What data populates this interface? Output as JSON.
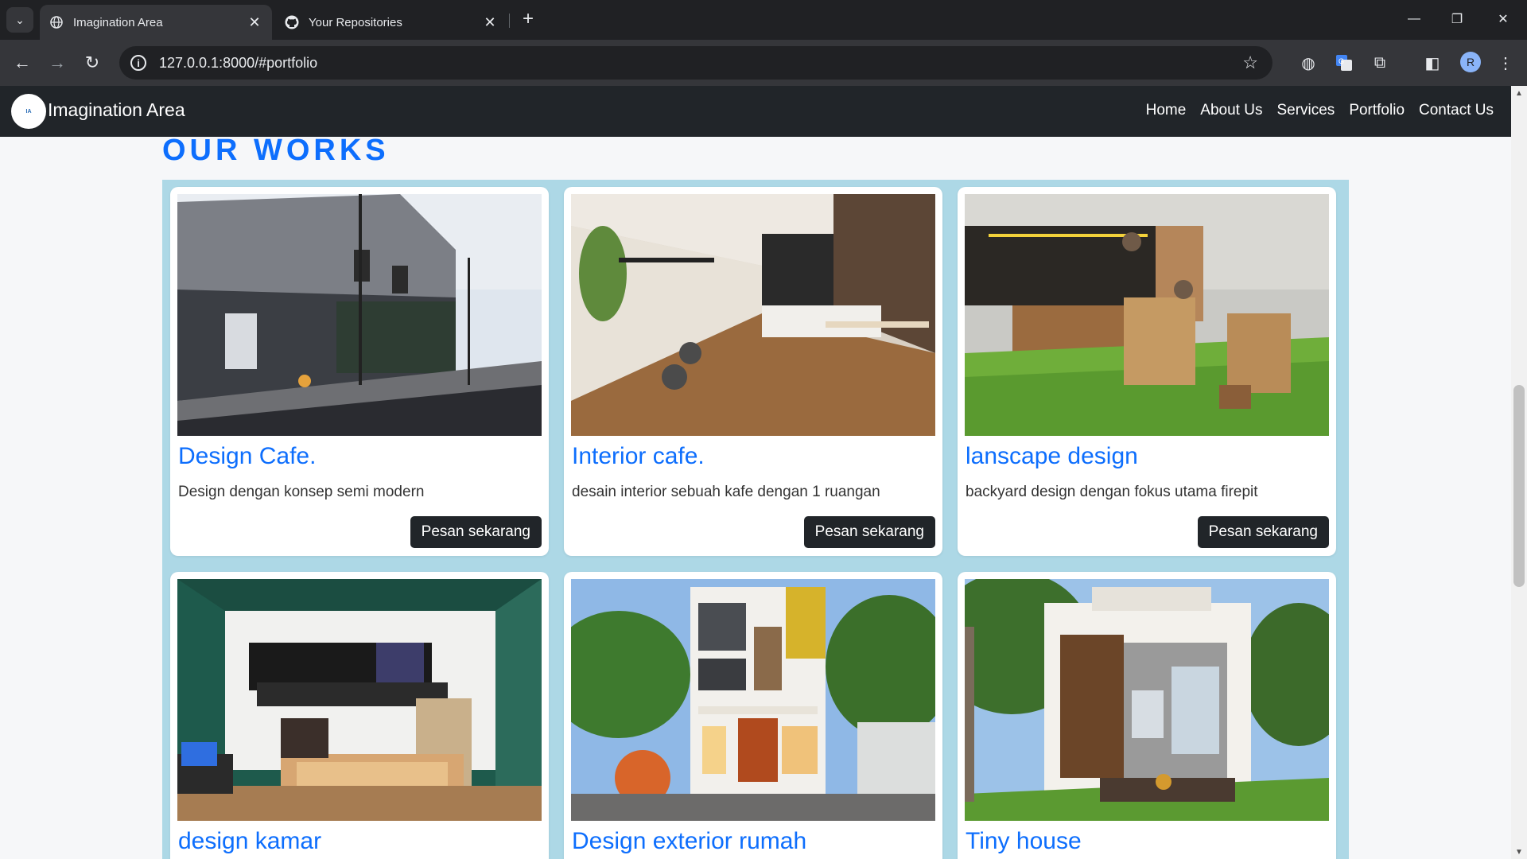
{
  "browser": {
    "tabs": [
      {
        "title": "Imagination Area",
        "icon": "globe-icon"
      },
      {
        "title": "Your Repositories",
        "icon": "github-icon"
      }
    ],
    "url": "127.0.0.1:8000/#portfolio",
    "profile_initial": "R"
  },
  "site": {
    "logo_text": "IA DESIGN",
    "brand": "Imagination Area",
    "nav": [
      "Home",
      "About Us",
      "Services",
      "Portfolio",
      "Contact Us"
    ]
  },
  "portfolio": {
    "title": "OUR WORKS",
    "items": [
      {
        "title": "Design Cafe.",
        "desc": "Design dengan konsep semi modern",
        "button": "Pesan sekarang"
      },
      {
        "title": "Interior cafe.",
        "desc": "desain interior sebuah kafe dengan 1 ruangan",
        "button": "Pesan sekarang"
      },
      {
        "title": "lanscape design",
        "desc": "backyard design dengan fokus utama firepit",
        "button": "Pesan sekarang"
      },
      {
        "title": "design kamar",
        "desc": "",
        "button": ""
      },
      {
        "title": "Design exterior rumah",
        "desc": "",
        "button": ""
      },
      {
        "title": "Tiny house",
        "desc": "",
        "button": ""
      }
    ]
  },
  "colors": {
    "accent": "#0d6efd",
    "navbar": "#212529",
    "portfolio_bg": "#add8e6"
  }
}
